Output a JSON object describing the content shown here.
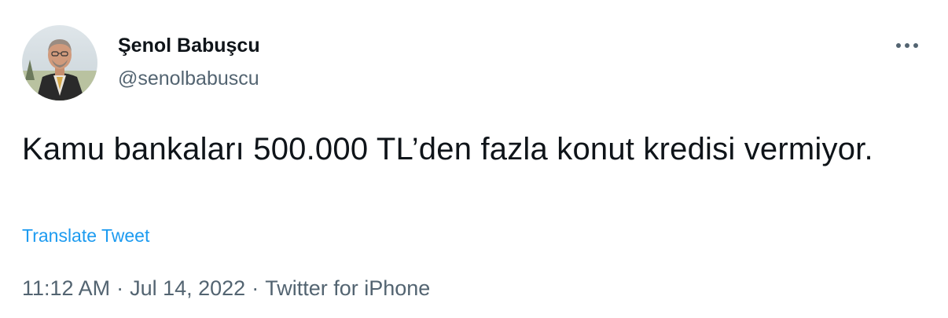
{
  "author": {
    "name": "Şenol Babuşcu",
    "handle": "@senolbabuscu"
  },
  "tweet": {
    "text": "Kamu bankaları 500.000 TL’den fazla konut kredisi vermiyor.",
    "translate_label": "Translate Tweet"
  },
  "meta": {
    "time": "11:12 AM",
    "separator": "·",
    "date": "Jul 14, 2022",
    "source": "Twitter for iPhone"
  },
  "icons": {
    "avatar": "avatar-photo",
    "more": "more-options-icon"
  },
  "colors": {
    "text": "#0f1419",
    "secondary": "#536471",
    "link": "#1d9bf0"
  }
}
